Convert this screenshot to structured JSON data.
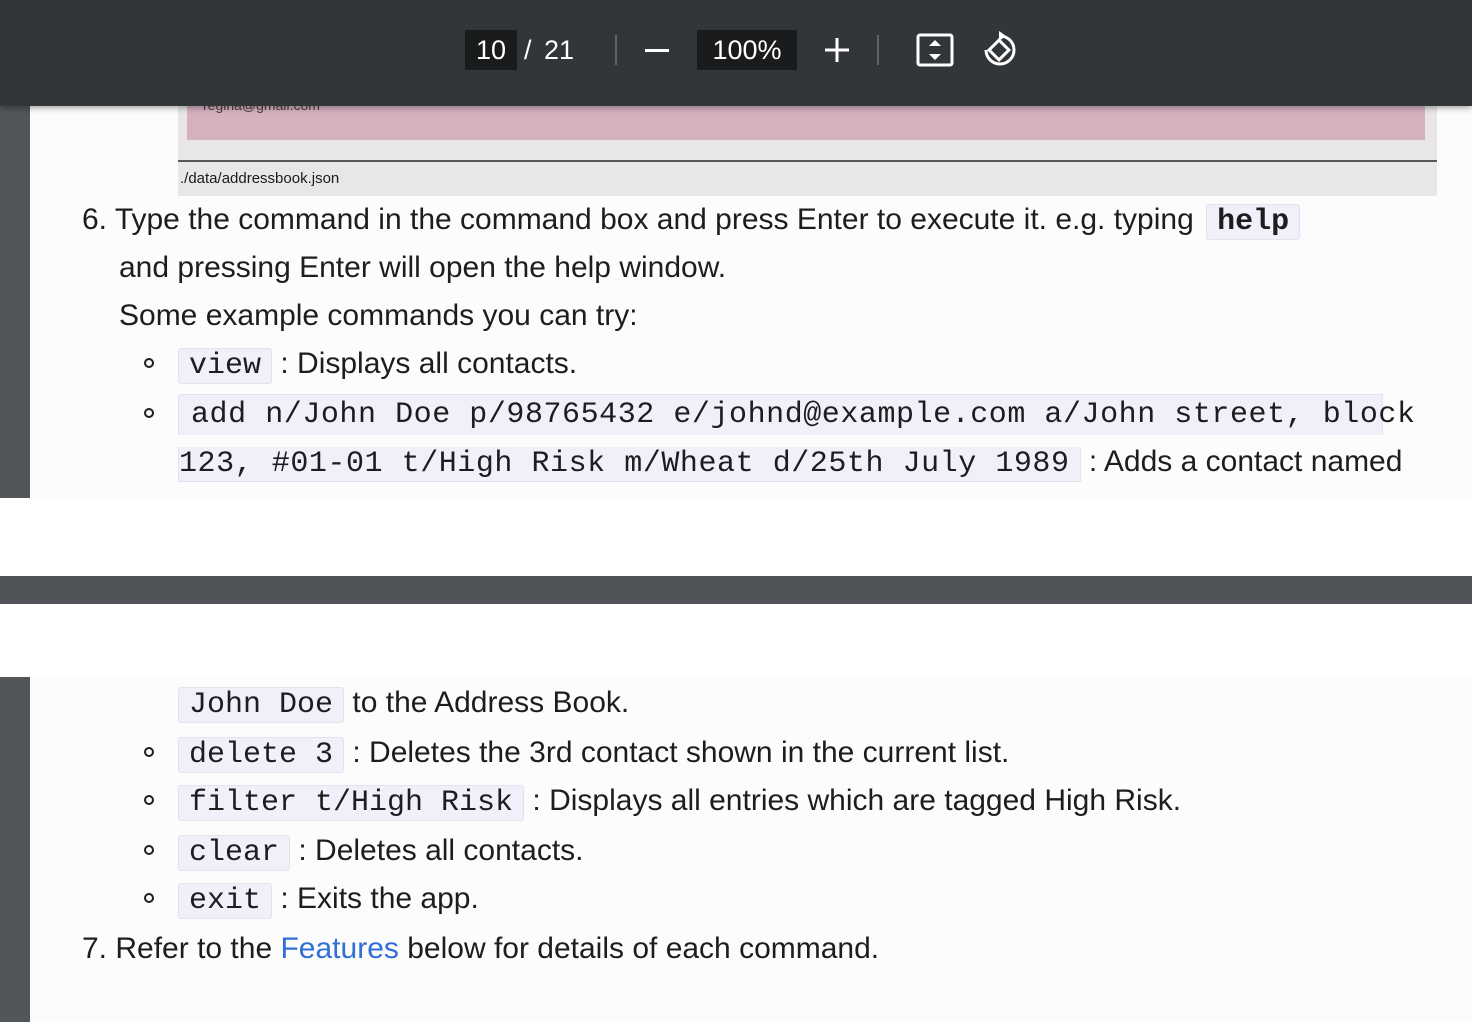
{
  "toolbar": {
    "page_current": "10",
    "page_separator": "/",
    "page_total": "21",
    "zoom_out_symbol": "—",
    "zoom_level": "100%",
    "zoom_in_symbol": "+",
    "fit_icon": "fit-to-page-icon",
    "rotate_icon": "rotate-icon"
  },
  "page1": {
    "screenshot_email": "regina@gmail.com",
    "screenshot_path": "./data/addressbook.json",
    "step6": {
      "number": "6.",
      "text_before": "Type the command in the command box and press Enter to execute it. e.g. typing",
      "code_help": "help",
      "line2": "and pressing Enter will open the help window.",
      "line3": "Some example commands you can try:"
    },
    "examples": [
      {
        "code": "view",
        "desc": ": Displays all contacts."
      },
      {
        "code_line1": "add n/John Doe p/98765432 e/johnd@example.com a/John street, block",
        "code_line2": "123, #01-01 t/High Risk m/Wheat d/25th July 1989",
        "desc": ": Adds a contact named"
      }
    ]
  },
  "page2": {
    "continued_code": "John Doe",
    "continued_text": "to the Address Book.",
    "examples": [
      {
        "code": "delete 3",
        "desc": ": Deletes the 3rd contact shown in the current list."
      },
      {
        "code": "filter t/High Risk",
        "desc": ": Displays all entries which are tagged High Risk."
      },
      {
        "code": "clear",
        "desc": ": Deletes all contacts."
      },
      {
        "code": "exit",
        "desc": ": Exits the app."
      }
    ],
    "step7": {
      "number": "7.",
      "text_before": "Refer to the",
      "link": "Features",
      "text_after": "below for details of each command."
    }
  },
  "colors": {
    "toolbar_bg": "#323639",
    "viewer_bg": "#525659",
    "page_bg": "#fcfcfd",
    "code_bg": "#f0f0fa",
    "link": "#2f6fd6",
    "screenshot_pink": "#d5b1bf"
  }
}
